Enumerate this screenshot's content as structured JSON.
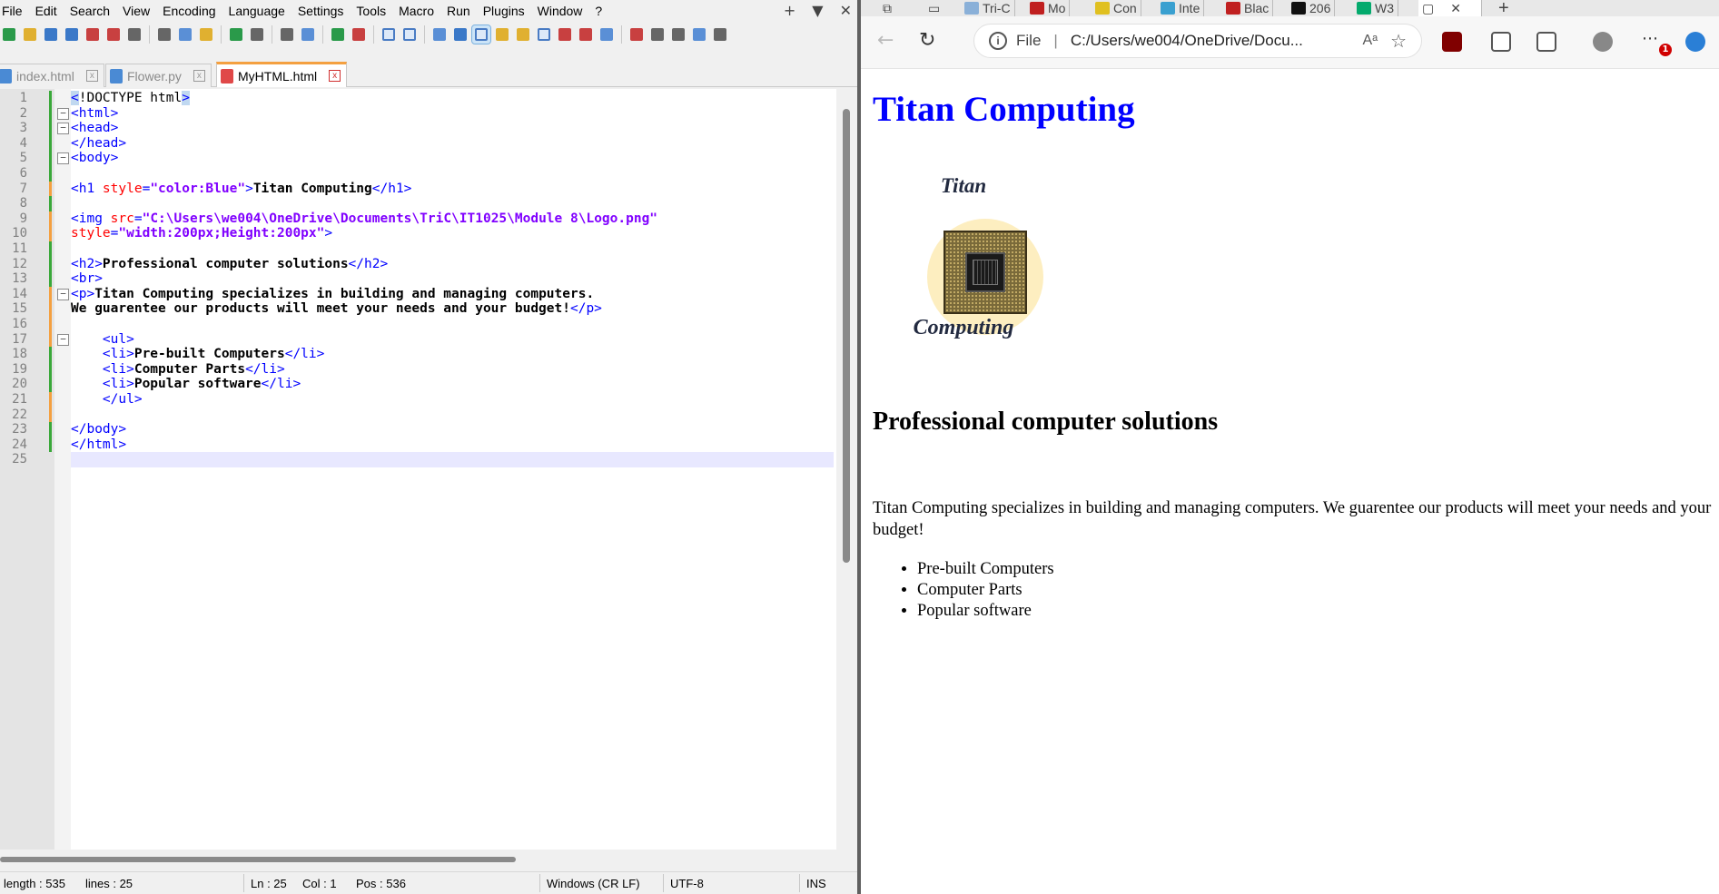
{
  "npp": {
    "menu": [
      "File",
      "Edit",
      "Search",
      "View",
      "Encoding",
      "Language",
      "Settings",
      "Tools",
      "Macro",
      "Run",
      "Plugins",
      "Window",
      "?"
    ],
    "window_controls": [
      "+",
      "▼",
      "✕"
    ],
    "tabs": [
      {
        "label": "index.html",
        "close": "x"
      },
      {
        "label": "Flower.py",
        "close": "x"
      },
      {
        "label": "MyHTML.html",
        "close": "x"
      }
    ],
    "lines": [
      {
        "n": "1",
        "html": "<span class=\"t-tag t-hl\">&lt;</span><span class=\"t-doc\">!DOCTYPE html</span><span class=\"t-tag t-hl\">&gt;</span>"
      },
      {
        "n": "2",
        "html": "<span class=\"t-tag\">&lt;html&gt;</span>"
      },
      {
        "n": "3",
        "html": "<span class=\"t-tag\">&lt;head&gt;</span>"
      },
      {
        "n": "4",
        "html": "<span class=\"t-tag\">&lt;/head&gt;</span>"
      },
      {
        "n": "5",
        "html": "<span class=\"t-tag\">&lt;body&gt;</span>"
      },
      {
        "n": "6",
        "html": ""
      },
      {
        "n": "7",
        "html": "<span class=\"t-tag\">&lt;h1 </span><span class=\"t-attr\">style</span><span class=\"t-tag\">=</span><span class=\"t-val\">\"color:Blue\"</span><span class=\"t-tag\">&gt;</span><span class=\"t-txt\">Titan Computing</span><span class=\"t-tag\">&lt;/h1&gt;</span>"
      },
      {
        "n": "8",
        "html": ""
      },
      {
        "n": "9",
        "html": "<span class=\"t-tag\">&lt;img </span><span class=\"t-attr\">src</span><span class=\"t-tag\">=</span><span class=\"t-val\">\"C:\\Users\\we004\\OneDrive\\Documents\\TriC\\IT1025\\Module 8\\Logo.png\"</span>"
      },
      {
        "n": "10",
        "html": "<span class=\"t-attr\">style</span><span class=\"t-tag\">=</span><span class=\"t-val\">\"width:200px;Height:200px\"</span><span class=\"t-tag\">&gt;</span>"
      },
      {
        "n": "11",
        "html": ""
      },
      {
        "n": "12",
        "html": "<span class=\"t-tag\">&lt;h2&gt;</span><span class=\"t-txt\">Professional computer solutions</span><span class=\"t-tag\">&lt;/h2&gt;</span>"
      },
      {
        "n": "13",
        "html": "<span class=\"t-tag\">&lt;br&gt;</span>"
      },
      {
        "n": "14",
        "html": "<span class=\"t-tag\">&lt;p&gt;</span><span class=\"t-txt\">Titan Computing specializes in building and managing computers.</span>"
      },
      {
        "n": "15",
        "html": "<span class=\"t-txt\">We guarentee our products will meet your needs and your budget!</span><span class=\"t-tag\">&lt;/p&gt;</span>"
      },
      {
        "n": "16",
        "html": ""
      },
      {
        "n": "17",
        "html": "    <span class=\"t-tag\">&lt;ul&gt;</span>"
      },
      {
        "n": "18",
        "html": "    <span class=\"t-tag\">&lt;li&gt;</span><span class=\"t-txt\">Pre-built Computers</span><span class=\"t-tag\">&lt;/li&gt;</span>"
      },
      {
        "n": "19",
        "html": "    <span class=\"t-tag\">&lt;li&gt;</span><span class=\"t-txt\">Computer Parts</span><span class=\"t-tag\">&lt;/li&gt;</span>"
      },
      {
        "n": "20",
        "html": "    <span class=\"t-tag\">&lt;li&gt;</span><span class=\"t-txt\">Popular software</span><span class=\"t-tag\">&lt;/li&gt;</span>"
      },
      {
        "n": "21",
        "html": "    <span class=\"t-tag\">&lt;/ul&gt;</span>"
      },
      {
        "n": "22",
        "html": ""
      },
      {
        "n": "23",
        "html": "<span class=\"t-tag\">&lt;/body&gt;</span>"
      },
      {
        "n": "24",
        "html": "<span class=\"t-tag\">&lt;/html&gt;</span>"
      },
      {
        "n": "25",
        "html": ""
      }
    ],
    "status": {
      "length": "length : 535",
      "lines": "lines : 25",
      "ln": "Ln : 25",
      "col": "Col : 1",
      "pos": "Pos : 536",
      "eol": "Windows (CR LF)",
      "encoding": "UTF-8",
      "mode": "INS"
    }
  },
  "browser": {
    "tabs": [
      {
        "label": "Tri-C",
        "color": "#8ab0d8"
      },
      {
        "label": "Mo",
        "color": "#c02020"
      },
      {
        "label": "Con",
        "color": "#e0c020"
      },
      {
        "label": "Inte",
        "color": "#3aa0d0"
      },
      {
        "label": "Blac",
        "color": "#c02020"
      },
      {
        "label": "206",
        "color": "#111111"
      },
      {
        "label": "W3",
        "color": "#04aa6d"
      }
    ],
    "address": {
      "protocol": "File",
      "url": "C:/Users/we004/OneDrive/Docu...",
      "read_aloud": "Aᵃ",
      "favorite": "☆"
    },
    "notification_count": "1",
    "page": {
      "heading": "Titan Computing",
      "logo": {
        "top_text": "Titan",
        "bottom_text": "Computing"
      },
      "subheading": "Professional computer solutions",
      "paragraph": "Titan Computing specializes in building and managing computers. We guarentee our products will meet your needs and your budget!",
      "list": [
        "Pre-built Computers",
        "Computer Parts",
        "Popular software"
      ]
    }
  },
  "colors": {
    "heading_blue": "#0000ff",
    "tag_blue": "#0000ff",
    "attr_red": "#ff0000",
    "value_purple": "#8000ff",
    "active_tab_orange": "#f4a040"
  }
}
